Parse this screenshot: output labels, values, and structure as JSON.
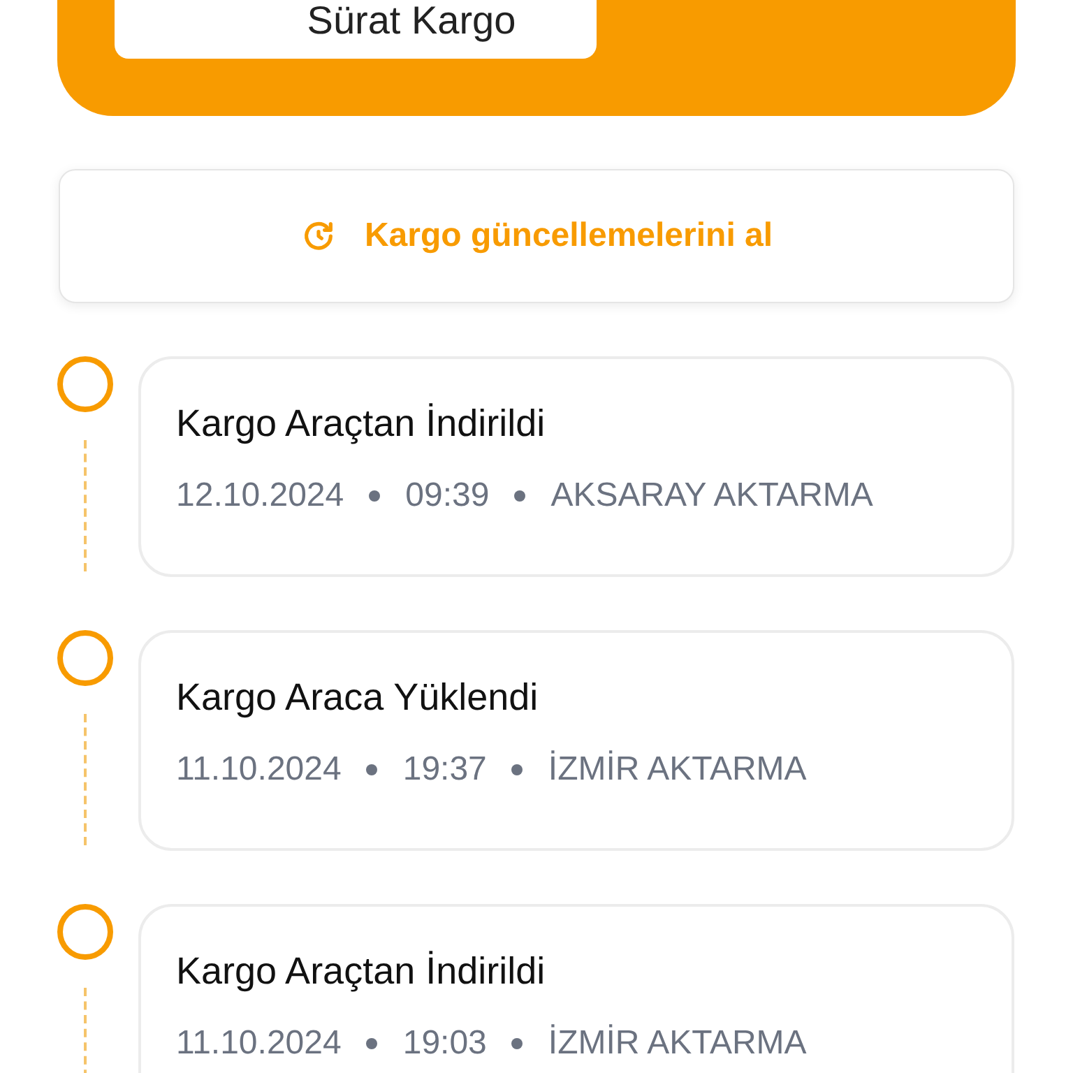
{
  "carrier_card": {
    "name": "Sürat Kargo"
  },
  "update_button": {
    "label": "Kargo güncellemelerini al"
  },
  "events": [
    {
      "title": "Kargo Araçtan İndirildi",
      "date": "12.10.2024",
      "time": "09:39",
      "location": "AKSARAY AKTARMA"
    },
    {
      "title": "Kargo Araca Yüklendi",
      "date": "11.10.2024",
      "time": "19:37",
      "location": "İZMİR AKTARMA"
    },
    {
      "title": "Kargo Araçtan İndirildi",
      "date": "11.10.2024",
      "time": "19:03",
      "location": "İZMİR AKTARMA"
    }
  ]
}
